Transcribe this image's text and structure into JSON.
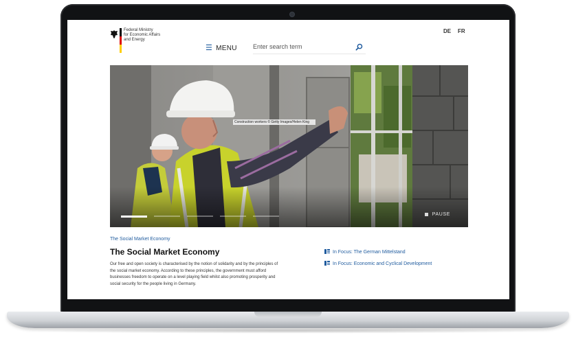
{
  "header": {
    "logo_lines": [
      "Federal Ministry",
      "for Economic Affairs",
      "and Energy"
    ],
    "menu_label": "MENU",
    "languages": [
      "DE",
      "FR"
    ]
  },
  "search": {
    "placeholder": "Enter search term",
    "value": ""
  },
  "hero": {
    "caption": "Construction workers © Getty Images/Helen King",
    "pause_label": "PAUSE",
    "slides_total": 5,
    "active_slide": 1
  },
  "content": {
    "breadcrumb": "The Social Market Economy",
    "title": "The Social Market Economy",
    "intro_lines": [
      "Our free and open society is characterised by the notion of solidarity and by the principles of",
      "the social market economy. According to these principles, the government must afford",
      "businesses freedom to operate on a level playing field whilst also promoting prosperity and",
      "social security for the people living in Germany."
    ]
  },
  "focus_links": [
    {
      "label": "In Focus: The German Mittelstand"
    },
    {
      "label": "In Focus: Economic and Cyclical Development"
    }
  ],
  "colors": {
    "link_blue": "#1f5b9e",
    "flag_black": "#000000",
    "flag_red": "#dd0000",
    "flag_gold": "#ffce00",
    "vest_yellow": "#c9d42e"
  }
}
